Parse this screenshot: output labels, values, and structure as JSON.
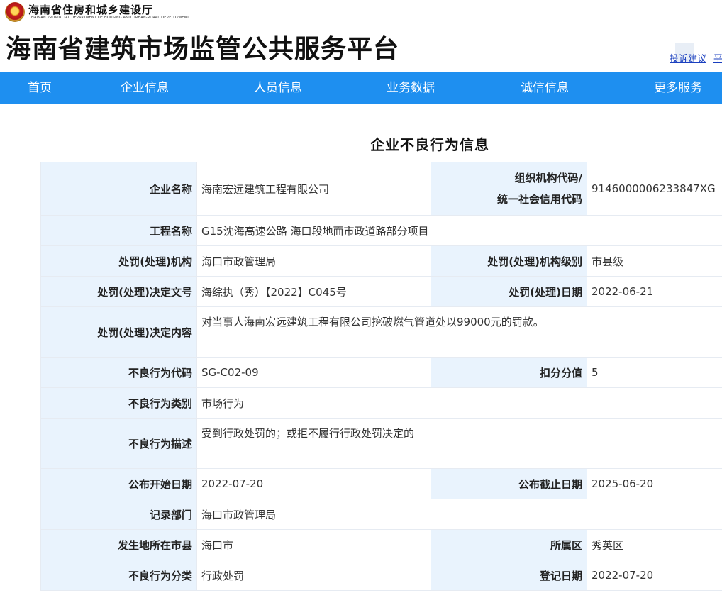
{
  "header": {
    "department_cn": "海南省住房和城乡建设厅",
    "department_en": "HAINAN PROVINCIAL DEPARTMENT OF HOUSING AND URBAN-RURAL DEVELOPMENT",
    "site_title": "海南省建筑市场监管公共服务平台",
    "links": {
      "complaint": "投诉建议",
      "more_partial": "平"
    }
  },
  "nav": {
    "items": [
      "首页",
      "企业信息",
      "人员信息",
      "业务数据",
      "诚信信息",
      "更多服务"
    ]
  },
  "page_heading": "企业不良行为信息",
  "details": {
    "company_name_label": "企业名称",
    "company_name": "海南宏远建筑工程有限公司",
    "org_code_label_1": "组织机构代码/",
    "org_code_label_2": "统一社会信用代码",
    "org_code": "9146000006233847XG",
    "project_label": "工程名称",
    "project": "G15沈海高速公路 海口段地面市政道路部分项目",
    "penalty_org_label": "处罚(处理)机构",
    "penalty_org": "海口市政管理局",
    "penalty_org_level_label": "处罚(处理)机构级别",
    "penalty_org_level": "市县级",
    "decision_no_label": "处罚(处理)决定文号",
    "decision_no": "海综执（秀）【2022】C045号",
    "penalty_date_label": "处罚(处理)日期",
    "penalty_date": "2022-06-21",
    "decision_content_label": "处罚(处理)决定内容",
    "decision_content": "对当事人海南宏远建筑工程有限公司挖破燃气管道处以99000元的罚款。",
    "behavior_code_label": "不良行为代码",
    "behavior_code": "SG-C02-09",
    "deduction_label": "扣分分值",
    "deduction": "5",
    "behavior_category_label": "不良行为类别",
    "behavior_category": "市场行为",
    "behavior_desc_label": "不良行为描述",
    "behavior_desc": "受到行政处罚的；或拒不履行行政处罚决定的",
    "publish_start_label": "公布开始日期",
    "publish_start": "2022-07-20",
    "publish_end_label": "公布截止日期",
    "publish_end": "2025-06-20",
    "record_dept_label": "记录部门",
    "record_dept": "海口市政管理局",
    "city_label": "发生地所在市县",
    "city": "海口市",
    "district_label": "所属区",
    "district": "秀英区",
    "classification_label": "不良行为分类",
    "classification": "行政处罚",
    "register_date_label": "登记日期",
    "register_date": "2022-07-20"
  },
  "colors": {
    "nav_bg": "#1e8ff0",
    "label_bg": "#e9f3fd",
    "link": "#1a3fbf"
  }
}
